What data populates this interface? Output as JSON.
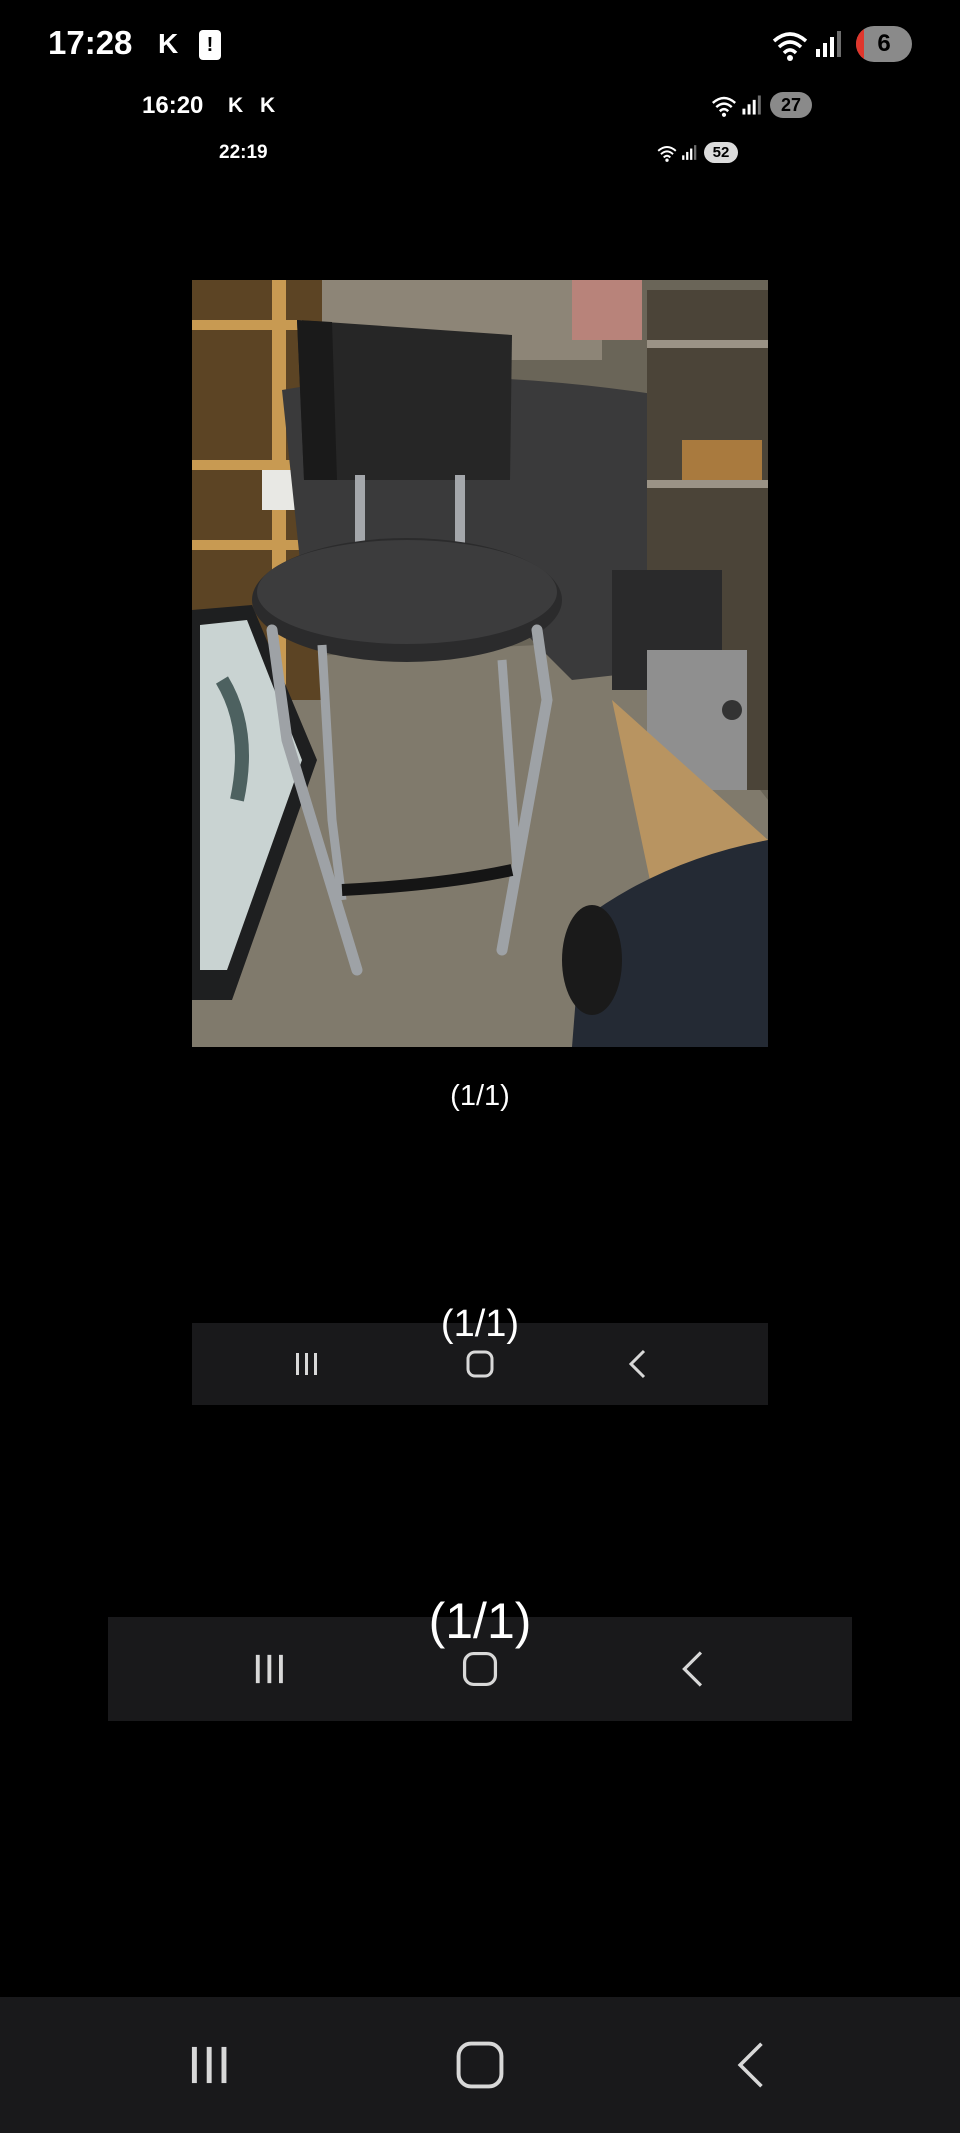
{
  "status_bars": [
    {
      "time": "17:28",
      "indicators": [
        "K"
      ],
      "battery_alert": "!",
      "badge": "6"
    },
    {
      "time": "16:20",
      "indicators": [
        "K",
        "K"
      ],
      "badge": "27"
    },
    {
      "time": "22:19",
      "badge": "52"
    }
  ],
  "image": {
    "icon": "photo",
    "caption": "(1/1)"
  },
  "ghost_captions": [
    "(1/1)",
    "(1/1)"
  ],
  "navigation": {
    "recents_icon": "recents-icon",
    "home_icon": "home-icon",
    "back_icon": "back-icon"
  },
  "colors": {
    "background": "#000000",
    "navbar": "#19191b",
    "battery_low": "#e0362c"
  }
}
